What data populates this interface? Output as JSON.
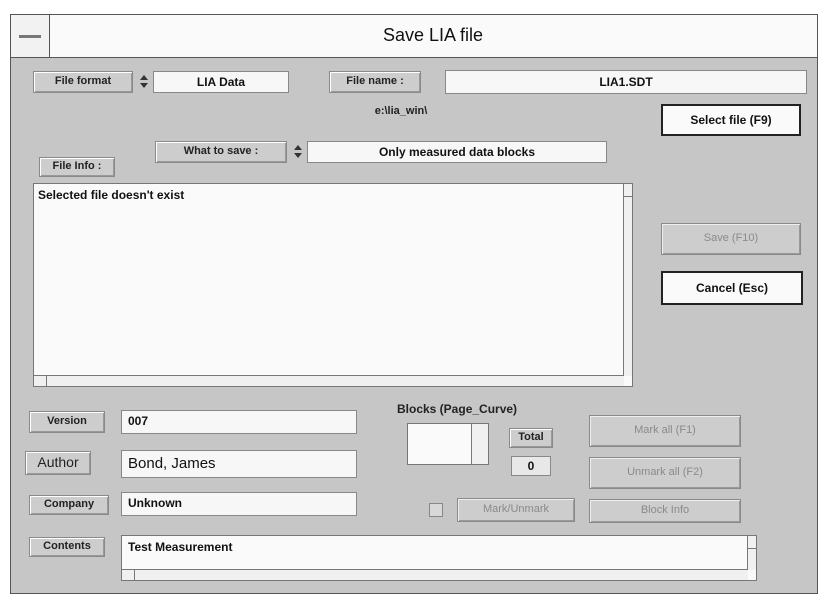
{
  "window": {
    "title": "Save LIA file"
  },
  "file_format": {
    "label": "File format",
    "value": "LIA Data"
  },
  "file_name": {
    "label": "File name :",
    "value": "LIA1.SDT",
    "path": "e:\\lia_win\\"
  },
  "select_file_label": "Select file (F9)",
  "what_to_save": {
    "label": "What to save :",
    "value": "Only measured data blocks"
  },
  "file_info": {
    "label": "File Info :",
    "text": "Selected file doesn't exist"
  },
  "save_label": "Save (F10)",
  "cancel_label": "Cancel (Esc)",
  "version": {
    "label": "Version",
    "value": "007"
  },
  "author": {
    "label": "Author",
    "value": "Bond, James"
  },
  "company": {
    "label": "Company",
    "value": "Unknown"
  },
  "contents": {
    "label": "Contents",
    "value": "Test Measurement"
  },
  "blocks": {
    "title": "Blocks (Page_Curve)",
    "total_label": "Total",
    "total_value": "0"
  },
  "mark_all_label": "Mark all (F1)",
  "unmark_all_label": "Unmark all (F2)",
  "mark_unmark_label": "Mark/Unmark",
  "block_info_label": "Block Info"
}
